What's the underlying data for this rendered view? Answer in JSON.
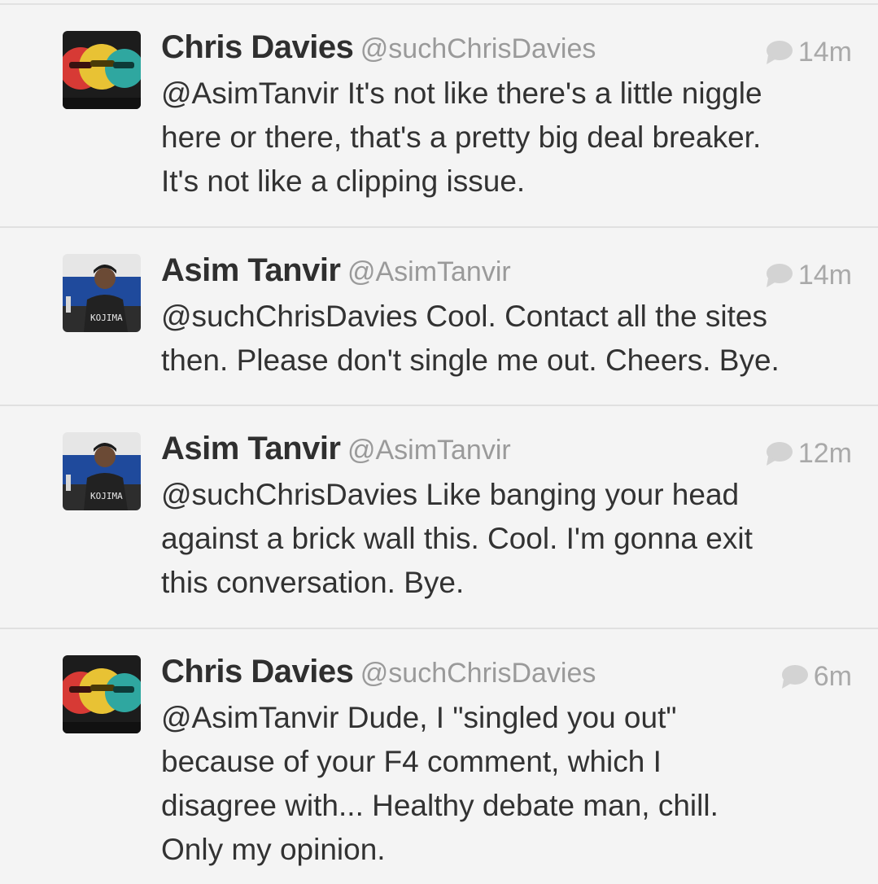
{
  "tweets": [
    {
      "name": "Chris Davies",
      "handle": "@suchChrisDavies",
      "time": "14m",
      "avatar": "chris-davies-avatar",
      "lines": [
        "@AsimTanvir It's not like there's a little niggle",
        "here or there, that's a pretty big deal breaker.",
        "It's not like a clipping issue."
      ]
    },
    {
      "name": "Asim Tanvir",
      "handle": "@AsimTanvir",
      "time": "14m",
      "avatar": "asim-tanvir-avatar",
      "avatar_text": "KOJIMA",
      "lines": [
        "@suchChrisDavies Cool. Contact all the sites",
        "then. Please don't single me out. Cheers. Bye."
      ]
    },
    {
      "name": "Asim Tanvir",
      "handle": "@AsimTanvir",
      "time": "12m",
      "avatar": "asim-tanvir-avatar",
      "avatar_text": "KOJIMA",
      "lines": [
        "@suchChrisDavies Like banging your head",
        "against a brick wall this. Cool. I'm gonna exit",
        "this conversation. Bye."
      ]
    },
    {
      "name": "Chris Davies",
      "handle": "@suchChrisDavies",
      "time": "6m",
      "avatar": "chris-davies-avatar",
      "lines": [
        "@AsimTanvir Dude, I \"singled you out\"",
        "because of your F4 comment, which I",
        "disagree with... Healthy debate man, chill.",
        "Only my opinion."
      ]
    }
  ],
  "icons": {
    "reply": "speech-bubble-icon"
  },
  "colors": {
    "background": "#f4f4f4",
    "name": "#2f2f2f",
    "handle": "#9a9a9a",
    "time": "#a9a9a9",
    "text": "#323232",
    "divider": "#e0e0e0"
  }
}
